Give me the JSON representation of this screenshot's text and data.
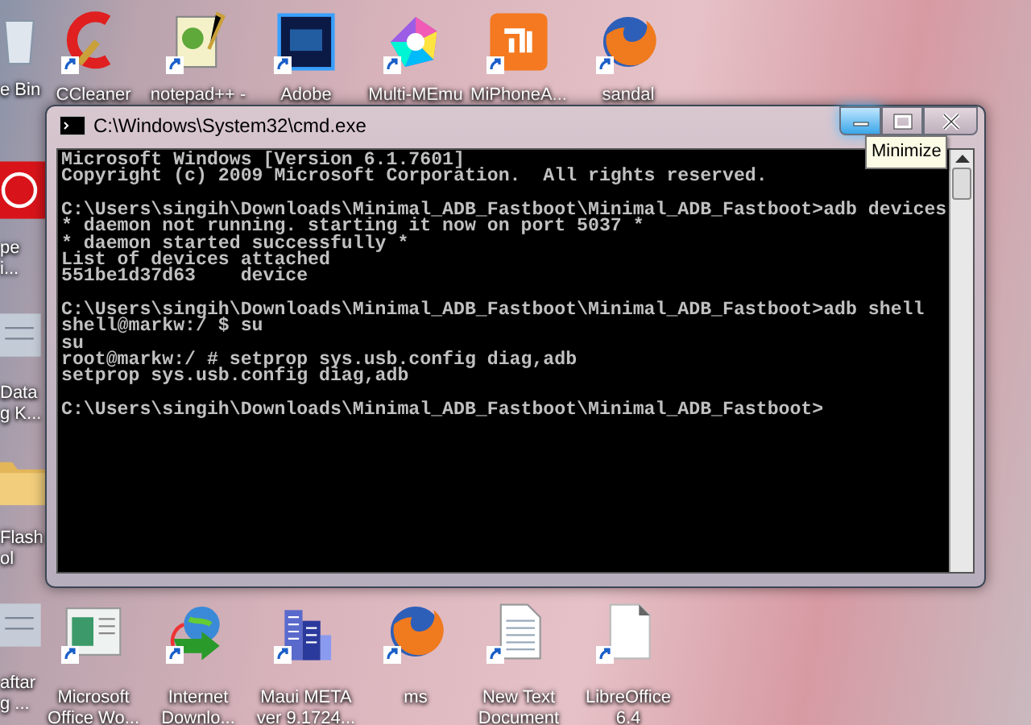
{
  "desktop_icons_top": [
    {
      "kind": "ccleaner",
      "label": "CCleaner"
    },
    {
      "kind": "notepad",
      "label": "notepad++ -"
    },
    {
      "kind": "ps",
      "label": "Adobe"
    },
    {
      "kind": "pinwheel",
      "label": "Multi-MEmu"
    },
    {
      "kind": "mi",
      "label": "MiPhoneA..."
    },
    {
      "kind": "firefox",
      "label": "sandal"
    }
  ],
  "desktop_icons_bottom": [
    {
      "kind": "office",
      "lines": [
        "Microsoft",
        "Office Wo..."
      ]
    },
    {
      "kind": "idm",
      "lines": [
        "Internet",
        "Downlo..."
      ]
    },
    {
      "kind": "building",
      "lines": [
        "Maui META",
        "ver 9.1724..."
      ]
    },
    {
      "kind": "firefox",
      "lines": [
        "ms"
      ]
    },
    {
      "kind": "textdoc",
      "lines": [
        "New Text",
        "Document"
      ]
    },
    {
      "kind": "libre",
      "lines": [
        "LibreOffice",
        "6.4"
      ]
    }
  ],
  "desktop_icons_left": [
    {
      "kind": "bin",
      "lines": [
        "e Bin"
      ]
    },
    {
      "kind": "red",
      "lines": [
        "pe",
        "i..."
      ]
    },
    {
      "kind": "grey",
      "lines": [
        "Data",
        "g K..."
      ]
    },
    {
      "kind": "folder",
      "lines": [
        "Flash",
        "ol"
      ]
    },
    {
      "kind": "grey",
      "lines": [
        "aftar",
        "g ..."
      ]
    }
  ],
  "window": {
    "title": "C:\\Windows\\System32\\cmd.exe",
    "buttons": [
      {
        "kind": "minimize",
        "hovered": true
      },
      {
        "kind": "maximize",
        "hovered": false
      },
      {
        "kind": "close",
        "hovered": false
      }
    ],
    "tooltip": "Minimize",
    "blocks": [
      {
        "lines": [
          "Microsoft Windows [Version 6.1.7601]",
          "Copyright (c) 2009 Microsoft Corporation.  All rights reserved."
        ]
      },
      {
        "lines": [
          "C:\\Users\\singih\\Downloads\\Minimal_ADB_Fastboot\\Minimal_ADB_Fastboot>adb devices",
          "* daemon not running. starting it now on port 5037 *",
          "* daemon started successfully *",
          "List of devices attached",
          "551be1d37d63    device"
        ]
      },
      {
        "lines": [
          "C:\\Users\\singih\\Downloads\\Minimal_ADB_Fastboot\\Minimal_ADB_Fastboot>adb shell",
          "shell@markw:/ $ su",
          "su",
          "root@markw:/ # setprop sys.usb.config diag,adb",
          "setprop sys.usb.config diag,adb"
        ]
      },
      {
        "lines": [
          "C:\\Users\\singih\\Downloads\\Minimal_ADB_Fastboot\\Minimal_ADB_Fastboot>"
        ]
      }
    ]
  }
}
